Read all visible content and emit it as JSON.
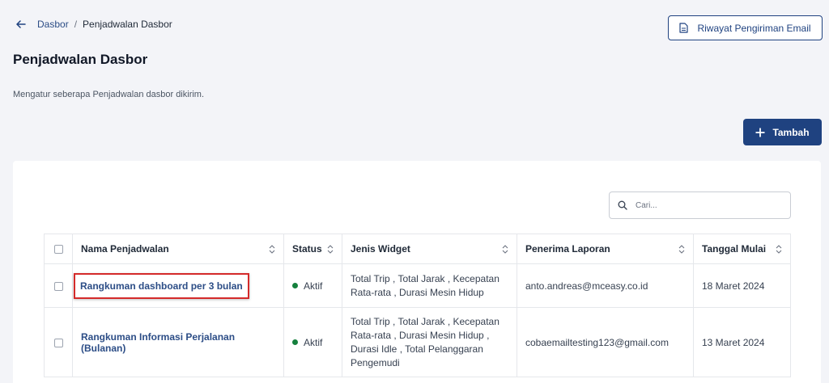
{
  "breadcrumb": {
    "parent": "Dasbor",
    "separator": "/",
    "current": "Penjadwalan Dasbor"
  },
  "header": {
    "history_button": "Riwayat Pengiriman Email",
    "title": "Penjadwalan Dasbor",
    "description": "Mengatur seberapa Penjadwalan dasbor dikirim.",
    "add_button": "Tambah"
  },
  "search": {
    "placeholder": "Cari..."
  },
  "table": {
    "columns": [
      "Nama Penjadwalan",
      "Status",
      "Jenis Widget",
      "Penerima Laporan",
      "Tanggal Mulai"
    ],
    "rows": [
      {
        "name": "Rangkuman dashboard per 3 bulan",
        "status": "Aktif",
        "widget_line1": "Total Trip , Total Jarak , Kecepatan",
        "widget_line2": "Rata-rata , Durasi Mesin Hidup",
        "recipient": "anto.andreas@mceasy.co.id",
        "start_date": "18 Maret 2024"
      },
      {
        "name": "Rangkuman Informasi Perjalanan (Bulanan)",
        "status": "Aktif",
        "widget_line1": "Total Trip , Total Jarak , Kecepatan",
        "widget_line2": "Rata-rata , Durasi Mesin Hidup ,",
        "widget_line3": "Durasi Idle , Total Pelanggaran",
        "widget_line4": "Pengemudi",
        "recipient": "cobaemailtesting123@gmail.com",
        "start_date": "13 Maret 2024"
      }
    ]
  },
  "colors": {
    "primary": "#1f4280",
    "link": "#2c4d86",
    "status_active": "#15803d",
    "highlight": "#d42a2a"
  },
  "icons": [
    "back-arrow-icon",
    "document-icon",
    "plus-icon",
    "search-icon",
    "sort-icon"
  ]
}
